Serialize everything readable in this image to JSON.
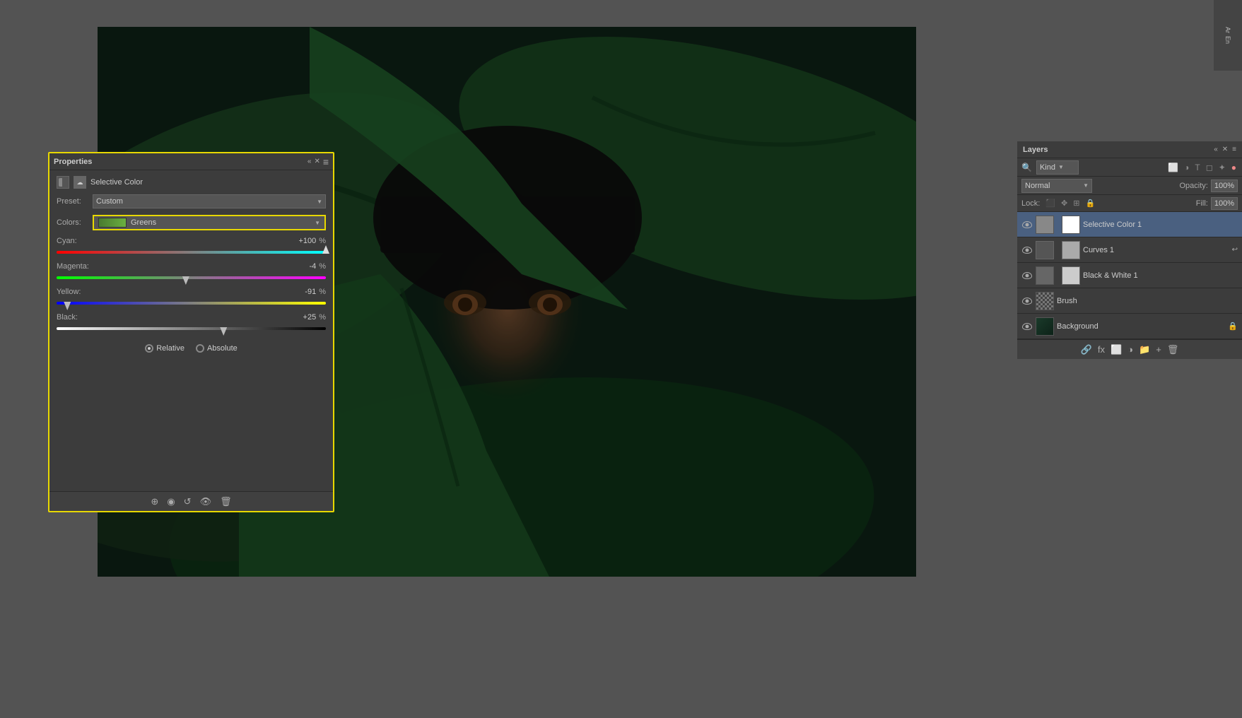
{
  "app": {
    "bg_color": "#535353"
  },
  "top_right": {
    "label1": "Ar",
    "label2": "En"
  },
  "properties_panel": {
    "title": "Properties",
    "preset_label": "Preset:",
    "preset_value": "Custom",
    "colors_label": "Colors:",
    "colors_value": "Greens",
    "sc_label": "Selective Color",
    "cyan_label": "Cyan:",
    "cyan_value": "+100",
    "cyan_pct": "%",
    "magenta_label": "Magenta:",
    "magenta_value": "-4",
    "magenta_pct": "%",
    "yellow_label": "Yellow:",
    "yellow_value": "-91",
    "yellow_pct": "%",
    "black_label": "Black:",
    "black_value": "+25",
    "black_pct": "%",
    "radio_relative": "Relative",
    "radio_absolute": "Absolute",
    "collapse_btn": "«",
    "close_btn": "✕",
    "menu_btn": "≡"
  },
  "layers_panel": {
    "title": "Layers",
    "collapse_btn": "«",
    "close_btn": "✕",
    "filter_label": "Kind",
    "blend_mode": "Normal",
    "opacity_label": "Opacity:",
    "opacity_value": "100%",
    "lock_label": "Lock:",
    "fill_label": "Fill:",
    "fill_value": "100%",
    "layers": [
      {
        "name": "Selective Color 1",
        "type": "adjustment",
        "visible": true
      },
      {
        "name": "Curves 1",
        "type": "adjustment",
        "visible": true
      },
      {
        "name": "Black & White 1",
        "type": "adjustment",
        "visible": true
      },
      {
        "name": "Brush",
        "type": "normal",
        "visible": true
      },
      {
        "name": "Background",
        "type": "background",
        "visible": true,
        "locked": true
      }
    ]
  }
}
